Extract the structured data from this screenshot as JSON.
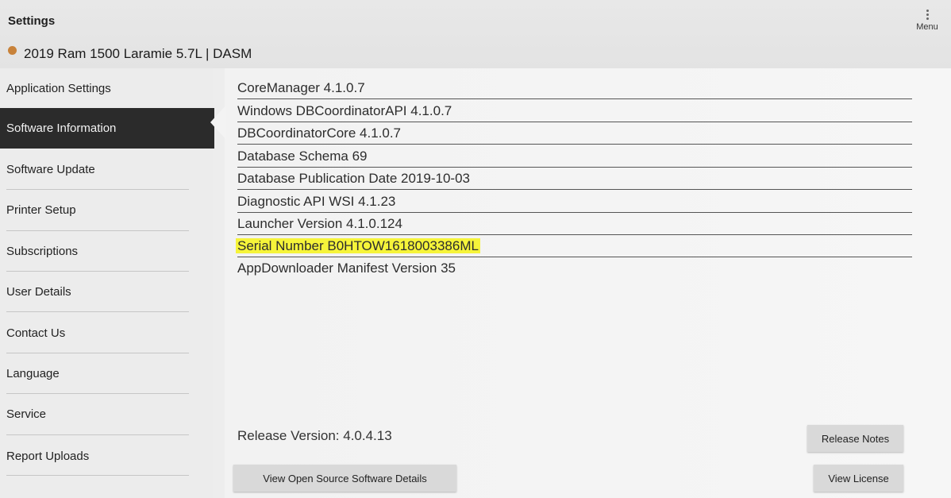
{
  "header": {
    "title": "Settings",
    "vehicle": "2019 Ram 1500 Laramie 5.7L | DASM",
    "menu_label": "Menu"
  },
  "sidebar": {
    "items": [
      {
        "label": "Application Settings"
      },
      {
        "label": "Software Information"
      },
      {
        "label": "Software Update"
      },
      {
        "label": "Printer Setup"
      },
      {
        "label": "Subscriptions"
      },
      {
        "label": "User Details"
      },
      {
        "label": "Contact Us"
      },
      {
        "label": "Language"
      },
      {
        "label": "Service"
      },
      {
        "label": "Report Uploads"
      }
    ],
    "active_index": 1
  },
  "software_info": {
    "rows": [
      "CoreManager 4.1.0.7",
      "Windows DBCoordinatorAPI 4.1.0.7",
      "DBCoordinatorCore 4.1.0.7",
      "Database Schema 69",
      "Database Publication Date 2019-10-03",
      "Diagnostic API WSI 4.1.23",
      "Launcher Version 4.1.0.124",
      "Serial Number B0HTOW1618003386ML",
      "AppDownloader Manifest Version 35"
    ],
    "highlight_color": "#f6f43a"
  },
  "footer": {
    "release_version": "Release Version: 4.0.4.13",
    "release_notes_button": "Release Notes",
    "open_source_button": "View Open Source Software Details",
    "license_button": "View License"
  }
}
